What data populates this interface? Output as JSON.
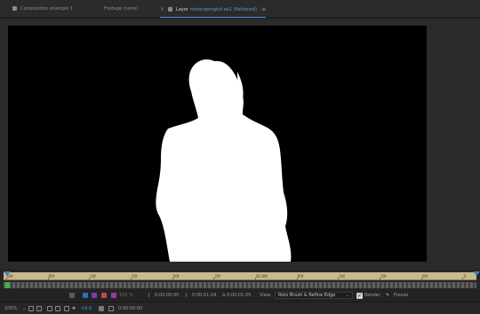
{
  "tabs": [
    {
      "label": "Composition example 1"
    },
    {
      "label": "Footage (none)"
    },
    {
      "prefix": "Layer",
      "layer_name": "rotoscopingtut-ex1 (flattened)"
    }
  ],
  "timeline": {
    "ticks": [
      "00f",
      "05f",
      "10f",
      "15f",
      "20f",
      "25f",
      "01:00f",
      "05f",
      "10f",
      "15f",
      "20f",
      "2:"
    ]
  },
  "controls": {
    "opacity": "100 %",
    "time_start": "0:00:00:00",
    "time_end": "0:00:01:24",
    "duration": "Δ 0:00:01:25",
    "view_label": "View:",
    "view_value": "Roto Brush & Refine Edge",
    "render_label": "Render",
    "freeze_label": "Freeze"
  },
  "bottombar": {
    "zoom": "100%",
    "exposure": "+0.0",
    "timecode": "0:00:00:00"
  },
  "colors": {
    "accent_blue": "#4a9fe8",
    "ruler": "#c9b98e",
    "workarea_start": "#3bb44a"
  }
}
